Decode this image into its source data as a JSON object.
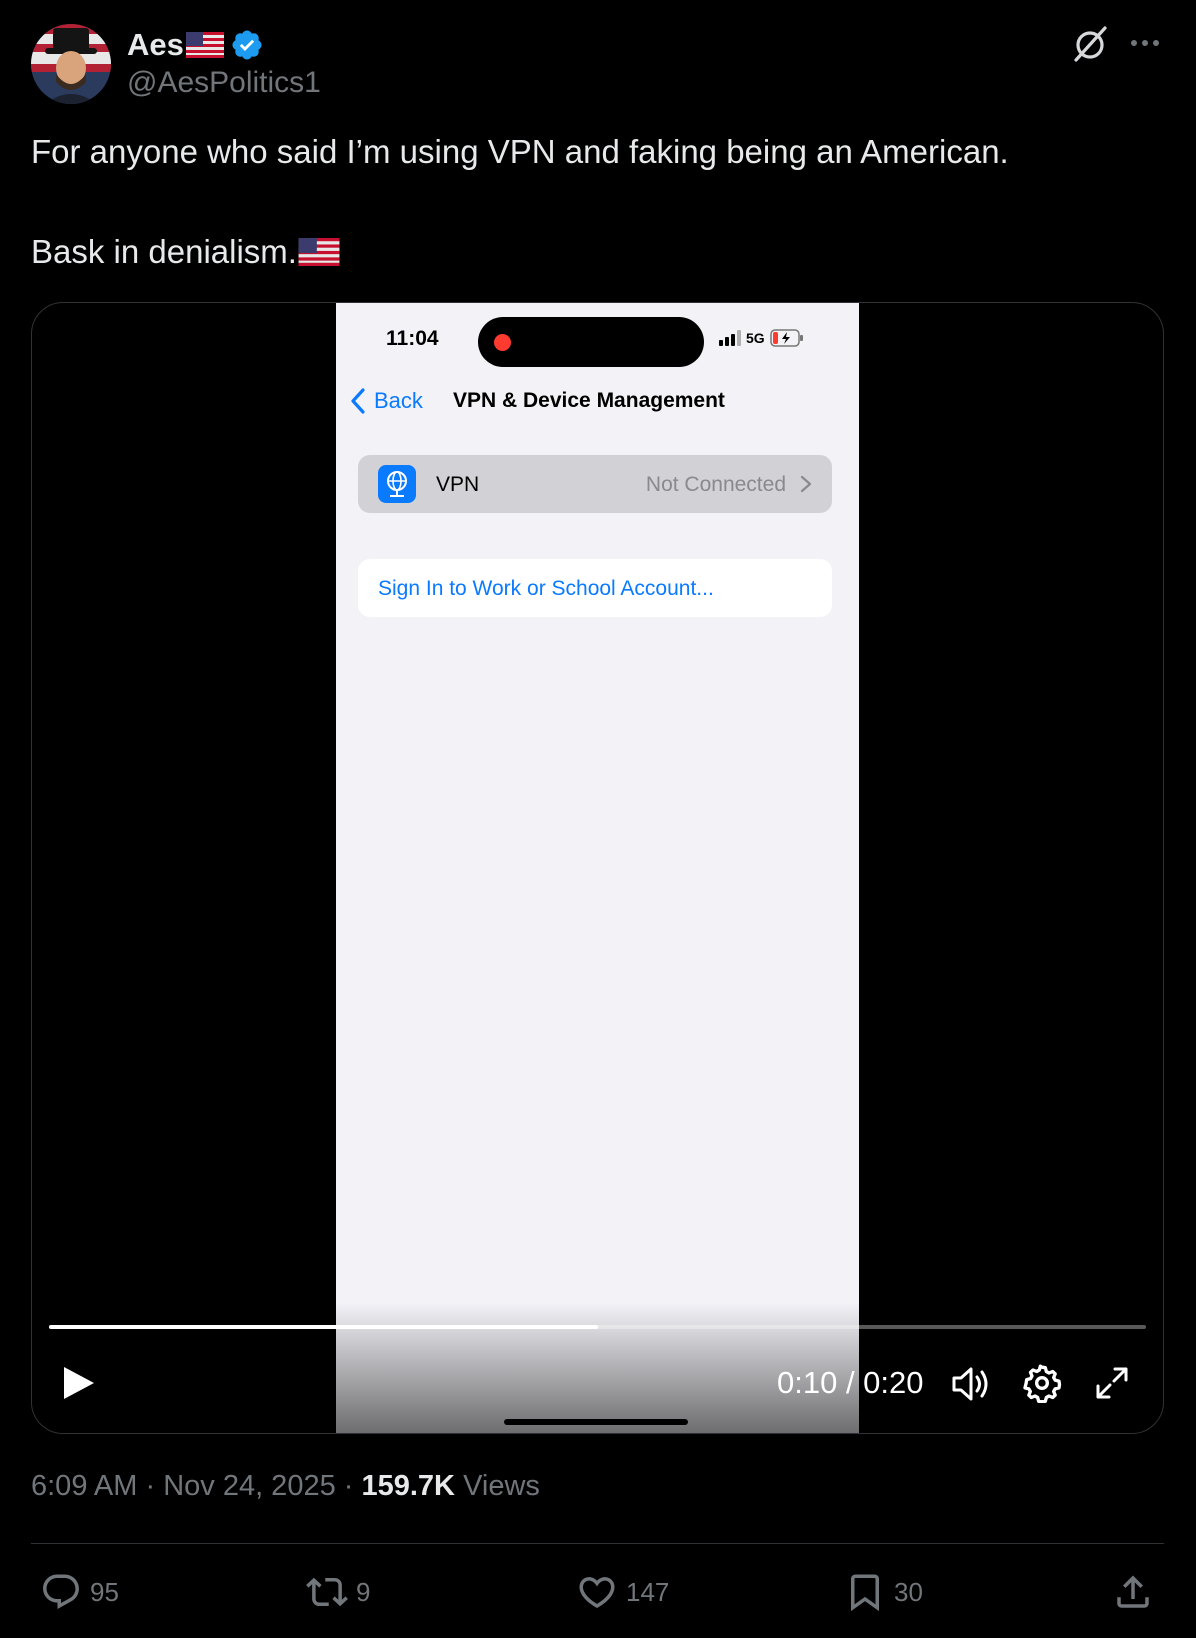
{
  "author": {
    "display_name": "Aes",
    "handle": "@AesPolitics1",
    "verified": true
  },
  "tweet": {
    "line1": "For anyone who said I’m using VPN and faking being an American.",
    "line2": "Bask in denialism."
  },
  "video": {
    "phone": {
      "time": "11:04",
      "network": "5G",
      "back_label": "Back",
      "title": "VPN & Device Management",
      "vpn_label": "VPN",
      "vpn_status": "Not Connected",
      "signin_label": "Sign In to Work or School Account..."
    },
    "progress_fraction": 0.5,
    "time_readout": "0:10 / 0:20"
  },
  "meta": {
    "time": "6:09 AM",
    "date": "Nov 24, 2025",
    "views_count": "159.7K",
    "views_label": "Views"
  },
  "actions": {
    "replies": "95",
    "reposts": "9",
    "likes": "147",
    "bookmarks": "30"
  },
  "colors": {
    "background": "#000000",
    "accent": "#1d9bf0",
    "muted": "#71767b",
    "ios_blue": "#0a7aff"
  }
}
